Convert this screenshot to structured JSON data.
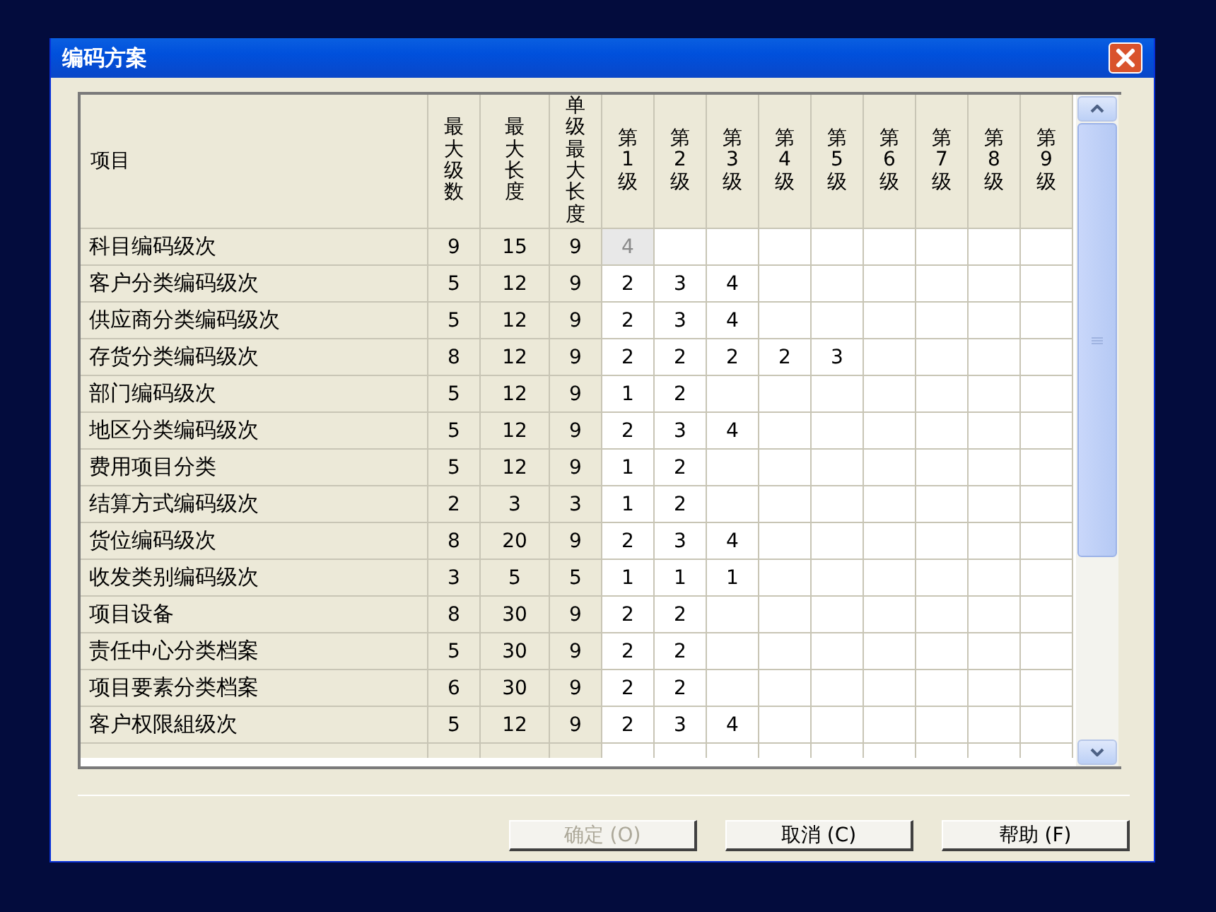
{
  "window": {
    "title": "编码方案"
  },
  "table": {
    "columns": [
      "项目",
      "最大级数",
      "最大长度",
      "单级最大长度",
      "第1级",
      "第2级",
      "第3级",
      "第4级",
      "第5级",
      "第6级",
      "第7级",
      "第8级",
      "第9级"
    ],
    "rows": [
      {
        "item": "科目编码级次",
        "max_levels": "9",
        "max_length": "15",
        "max_single": "9",
        "levels": [
          "4"
        ],
        "first_level_disabled": true
      },
      {
        "item": "客户分类编码级次",
        "max_levels": "5",
        "max_length": "12",
        "max_single": "9",
        "levels": [
          "2",
          "3",
          "4"
        ],
        "first_level_disabled": false
      },
      {
        "item": "供应商分类编码级次",
        "max_levels": "5",
        "max_length": "12",
        "max_single": "9",
        "levels": [
          "2",
          "3",
          "4"
        ],
        "first_level_disabled": false
      },
      {
        "item": "存货分类编码级次",
        "max_levels": "8",
        "max_length": "12",
        "max_single": "9",
        "levels": [
          "2",
          "2",
          "2",
          "2",
          "3"
        ],
        "first_level_disabled": false
      },
      {
        "item": "部门编码级次",
        "max_levels": "5",
        "max_length": "12",
        "max_single": "9",
        "levels": [
          "1",
          "2"
        ],
        "first_level_disabled": false
      },
      {
        "item": "地区分类编码级次",
        "max_levels": "5",
        "max_length": "12",
        "max_single": "9",
        "levels": [
          "2",
          "3",
          "4"
        ],
        "first_level_disabled": false
      },
      {
        "item": "费用项目分类",
        "max_levels": "5",
        "max_length": "12",
        "max_single": "9",
        "levels": [
          "1",
          "2"
        ],
        "first_level_disabled": false
      },
      {
        "item": "结算方式编码级次",
        "max_levels": "2",
        "max_length": "3",
        "max_single": "3",
        "levels": [
          "1",
          "2"
        ],
        "first_level_disabled": false
      },
      {
        "item": "货位编码级次",
        "max_levels": "8",
        "max_length": "20",
        "max_single": "9",
        "levels": [
          "2",
          "3",
          "4"
        ],
        "first_level_disabled": false
      },
      {
        "item": "收发类别编码级次",
        "max_levels": "3",
        "max_length": "5",
        "max_single": "5",
        "levels": [
          "1",
          "1",
          "1"
        ],
        "first_level_disabled": false
      },
      {
        "item": "项目设备",
        "max_levels": "8",
        "max_length": "30",
        "max_single": "9",
        "levels": [
          "2",
          "2"
        ],
        "first_level_disabled": false
      },
      {
        "item": "责任中心分类档案",
        "max_levels": "5",
        "max_length": "30",
        "max_single": "9",
        "levels": [
          "2",
          "2"
        ],
        "first_level_disabled": false
      },
      {
        "item": "项目要素分类档案",
        "max_levels": "6",
        "max_length": "30",
        "max_single": "9",
        "levels": [
          "2",
          "2"
        ],
        "first_level_disabled": false
      },
      {
        "item": "客户权限組级次",
        "max_levels": "5",
        "max_length": "12",
        "max_single": "9",
        "levels": [
          "2",
          "3",
          "4"
        ],
        "first_level_disabled": false
      }
    ]
  },
  "buttons": [
    {
      "label": "确定 (O)",
      "disabled": true
    },
    {
      "label": "取消 (C)",
      "disabled": false
    },
    {
      "label": "帮助 (F)",
      "disabled": false
    }
  ]
}
